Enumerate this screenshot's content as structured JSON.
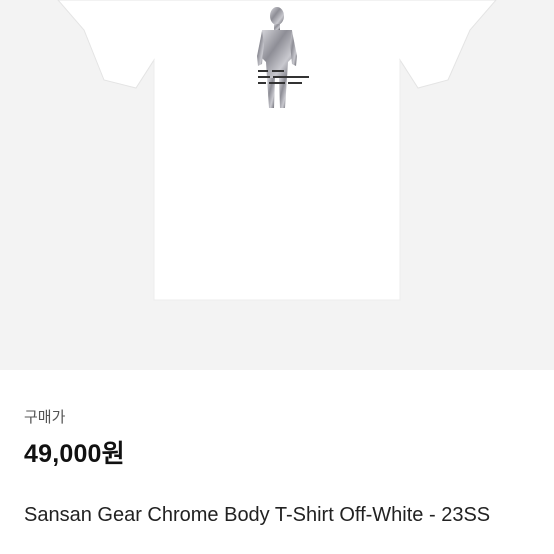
{
  "product": {
    "image_alt": "White t-shirt with chrome body print",
    "price_label": "구매가",
    "price": "49,000원",
    "title": "Sansan Gear Chrome Body T-Shirt Off-White - 23SS"
  },
  "colors": {
    "background": "#ffffff",
    "image_background": "#f3f3f3",
    "price_text": "#111111",
    "label_text": "#555555"
  }
}
